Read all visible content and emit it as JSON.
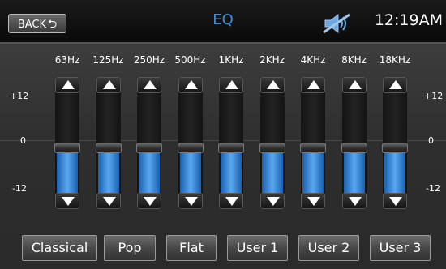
{
  "header": {
    "back_label": "BACK",
    "back_arrow": "⮌",
    "title": "EQ",
    "mute_icon": "mute-speaker-icon",
    "clock": "12:19AM"
  },
  "scale": {
    "top": "+12",
    "mid": "0",
    "bottom": "-12"
  },
  "bands": [
    {
      "label": "63Hz",
      "level": -1
    },
    {
      "label": "125Hz",
      "level": -1
    },
    {
      "label": "250Hz",
      "level": -1
    },
    {
      "label": "500Hz",
      "level": -1
    },
    {
      "label": "1KHz",
      "level": -1
    },
    {
      "label": "2KHz",
      "level": -1
    },
    {
      "label": "4KHz",
      "level": -1
    },
    {
      "label": "8KHz",
      "level": -1
    },
    {
      "label": "18KHz",
      "level": -1
    }
  ],
  "presets": [
    "Classical",
    "Pop",
    "Flat",
    "User 1",
    "User 2",
    "User 3"
  ],
  "colors": {
    "accent": "#3a8fe0",
    "slider_fill": "#3f8de0",
    "background": "#2c2c2c"
  }
}
